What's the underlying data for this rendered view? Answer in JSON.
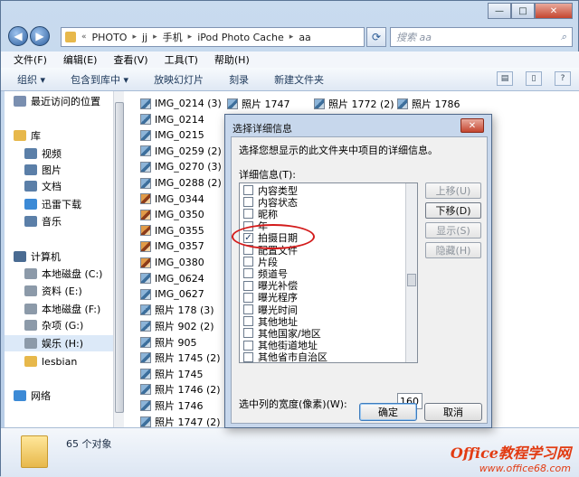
{
  "window": {
    "minimize": "—",
    "maximize": "□",
    "close": "✕"
  },
  "nav": {
    "back": "◀",
    "forward": "▶",
    "breadcrumb": [
      "PHOTO",
      "jj",
      "手机",
      "iPod Photo Cache",
      "aa"
    ],
    "search_placeholder": "搜索 aa"
  },
  "menu": [
    "文件(F)",
    "编辑(E)",
    "查看(V)",
    "工具(T)",
    "帮助(H)"
  ],
  "toolbar": [
    "组织 ▾",
    "包含到库中 ▾",
    "放映幻灯片",
    "刻录",
    "新建文件夹"
  ],
  "sidebar": [
    {
      "label": "最近访问的位置",
      "color": "#7a8fb0"
    },
    {
      "label": "库",
      "color": "#e7b84b"
    },
    {
      "label": "视频",
      "color": "#5b7fa8"
    },
    {
      "label": "图片",
      "color": "#5b7fa8"
    },
    {
      "label": "文档",
      "color": "#5b7fa8"
    },
    {
      "label": "迅雷下载",
      "color": "#3c8ad6"
    },
    {
      "label": "音乐",
      "color": "#5b7fa8"
    },
    {
      "label": "计算机",
      "color": "#4a6b92"
    },
    {
      "label": "本地磁盘 (C:)",
      "color": "#8c9aa9"
    },
    {
      "label": "资料 (E:)",
      "color": "#8c9aa9"
    },
    {
      "label": "本地磁盘 (F:)",
      "color": "#8c9aa9"
    },
    {
      "label": "杂项 (G:)",
      "color": "#8c9aa9"
    },
    {
      "label": "娱乐 (H:)",
      "color": "#8c9aa9"
    },
    {
      "label": "lesbian",
      "color": "#e7b84b"
    },
    {
      "label": "网络",
      "color": "#3c8ad6"
    }
  ],
  "files_col1": [
    "IMG_0214 (3)",
    "IMG_0214",
    "IMG_0215",
    "IMG_0259 (2)",
    "IMG_0270 (3)",
    "IMG_0288 (2)",
    "IMG_0344",
    "IMG_0350",
    "IMG_0355",
    "IMG_0357",
    "IMG_0380",
    "IMG_0624",
    "IMG_0627",
    "照片 178 (3)",
    "照片 902 (2)",
    "照片 905",
    "照片 1745 (2)",
    "照片 1745",
    "照片 1746 (2)",
    "照片 1746",
    "照片 1747 (2)"
  ],
  "files_top": [
    "照片 1747",
    "照片 1772 (2)",
    "照片 1786"
  ],
  "dialog": {
    "title": "选择详细信息",
    "close": "✕",
    "description": "选择您想显示的此文件夹中项目的详细信息。",
    "list_label": "详细信息(T):",
    "items": [
      {
        "label": "内容类型",
        "checked": false
      },
      {
        "label": "内容状态",
        "checked": false
      },
      {
        "label": "昵称",
        "checked": false
      },
      {
        "label": "年",
        "checked": false
      },
      {
        "label": "拍摄日期",
        "checked": true
      },
      {
        "label": "配置文件",
        "checked": false
      },
      {
        "label": "片段",
        "checked": false
      },
      {
        "label": "频道号",
        "checked": false
      },
      {
        "label": "曝光补偿",
        "checked": false
      },
      {
        "label": "曝光程序",
        "checked": false
      },
      {
        "label": "曝光时间",
        "checked": false
      },
      {
        "label": "其他地址",
        "checked": false
      },
      {
        "label": "其他国家/地区",
        "checked": false
      },
      {
        "label": "其他街道地址",
        "checked": false
      },
      {
        "label": "其他省市自治区",
        "checked": false
      }
    ],
    "buttons": {
      "up": "上移(U)",
      "down": "下移(D)",
      "show": "显示(S)",
      "hide": "隐藏(H)"
    },
    "width_label": "选中列的宽度(像素)(W):",
    "width_value": "160",
    "ok": "确定",
    "cancel": "取消"
  },
  "status": {
    "count": "65 个对象"
  },
  "watermark": {
    "line1": "Office教程学习网",
    "line2": "www.office68.com"
  }
}
